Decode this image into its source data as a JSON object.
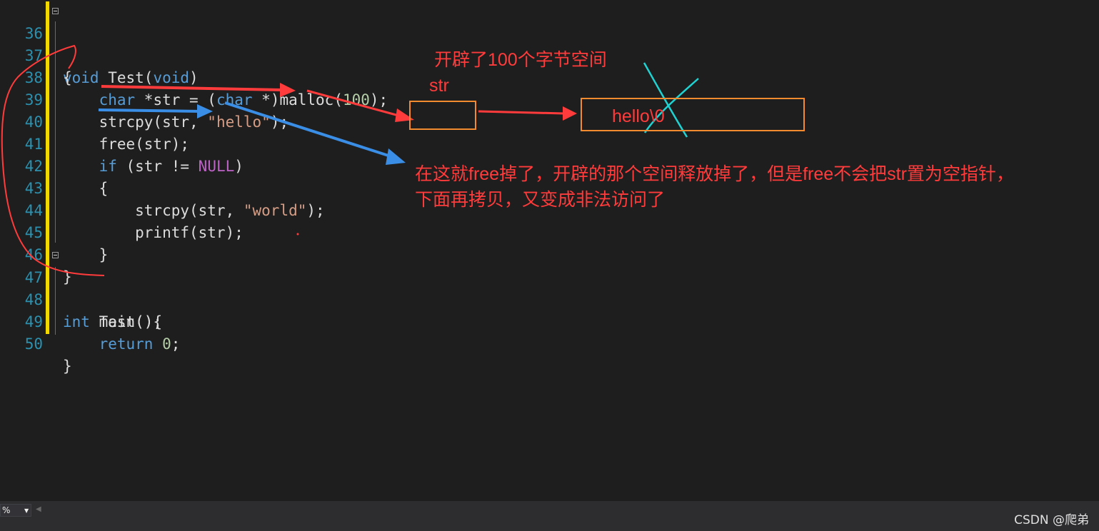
{
  "editor": {
    "lines": [
      {
        "num": "36",
        "code": "void Test(void)"
      },
      {
        "num": "37",
        "code": "{"
      },
      {
        "num": "38",
        "code": "    char *str = (char *)malloc(100);"
      },
      {
        "num": "39",
        "code": "    strcpy(str, \"hello\");"
      },
      {
        "num": "40",
        "code": "    free(str);"
      },
      {
        "num": "41",
        "code": "    if (str != NULL)"
      },
      {
        "num": "42",
        "code": "    {"
      },
      {
        "num": "43",
        "code": "        strcpy(str, \"world\");"
      },
      {
        "num": "44",
        "code": "        printf(str);"
      },
      {
        "num": "45",
        "code": "    }"
      },
      {
        "num": "46",
        "code": "}"
      },
      {
        "num": "47",
        "code": "int main(){"
      },
      {
        "num": "48",
        "code": "    Test();"
      },
      {
        "num": "49",
        "code": "    return 0;"
      },
      {
        "num": "50",
        "code": "}"
      }
    ]
  },
  "annotations": {
    "malloc_note": "开辟了100个字节空间",
    "str_label": "str",
    "heap_content": "hello\\0",
    "free_note_line1": "在这就free掉了，开辟的那个空间释放掉了，但是free不会把str置为空指针，",
    "free_note_line2": "下面再拷贝，又变成非法访问了"
  },
  "statusbar": {
    "zoom_value": "%",
    "watermark": "CSDN @爬弟"
  },
  "colors": {
    "background": "#1e1e1e",
    "line_number": "#2b91af",
    "keyword": "#569cd6",
    "string": "#d69d85",
    "number": "#b5cea8",
    "macro": "#bd63c5",
    "annotation_red": "#ff3b3b",
    "box_orange": "#f28b30",
    "arrow_blue": "#3a8ee6",
    "cross_cyan": "#1fd3d3",
    "change_bar": "#f2d900"
  }
}
